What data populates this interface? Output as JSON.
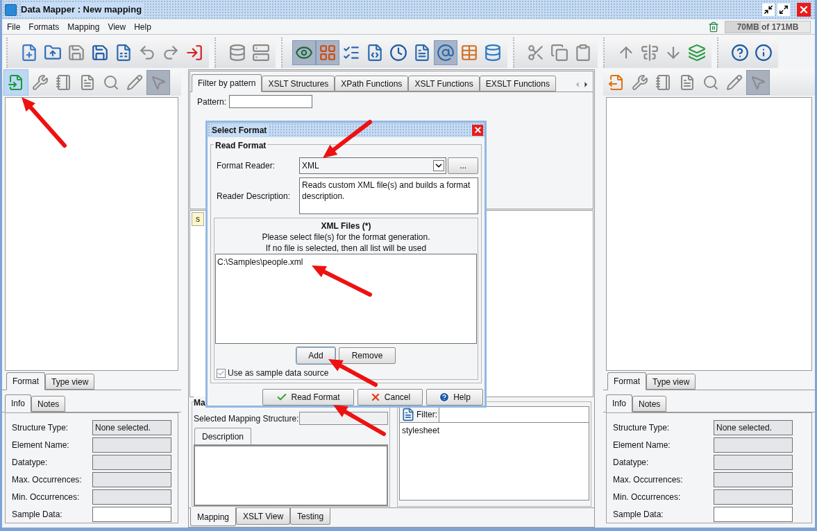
{
  "window": {
    "title": "Data Mapper : New mapping"
  },
  "menu": [
    {
      "label": "File"
    },
    {
      "label": "Formats"
    },
    {
      "label": "Mapping"
    },
    {
      "label": "View"
    },
    {
      "label": "Help"
    }
  ],
  "memory": {
    "label": "70MB of 171MB",
    "level": 0.42
  },
  "toolbar": {
    "groups": [
      [
        {
          "pressed": false,
          "disabled": false
        },
        {
          "pressed": false,
          "disabled": false
        },
        {
          "pressed": false,
          "disabled": true
        },
        {
          "pressed": false,
          "disabled": false
        },
        {
          "pressed": false,
          "disabled": false
        },
        {
          "pressed": false,
          "disabled": true
        },
        {
          "pressed": false,
          "disabled": true
        },
        {
          "pressed": false,
          "disabled": false
        }
      ],
      [
        {
          "pressed": false,
          "disabled": true
        },
        {
          "pressed": false,
          "disabled": true
        }
      ],
      [
        {
          "pressed": true,
          "disabled": false
        },
        {
          "pressed": true,
          "disabled": false
        },
        {
          "pressed": false,
          "disabled": false
        },
        {
          "pressed": false,
          "disabled": false
        },
        {
          "pressed": false,
          "disabled": false
        },
        {
          "pressed": false,
          "disabled": false
        },
        {
          "pressed": true,
          "disabled": false
        },
        {
          "pressed": false,
          "disabled": false
        },
        {
          "pressed": false,
          "disabled": false
        }
      ],
      [
        {
          "pressed": false,
          "disabled": true
        },
        {
          "pressed": false,
          "disabled": true
        },
        {
          "pressed": false,
          "disabled": true
        }
      ],
      [
        {
          "pressed": false,
          "disabled": true
        },
        {
          "pressed": false,
          "disabled": true
        },
        {
          "pressed": false,
          "disabled": true
        },
        {
          "pressed": false,
          "disabled": false
        }
      ],
      [
        {
          "pressed": false,
          "disabled": false
        },
        {
          "pressed": false,
          "disabled": false
        }
      ]
    ]
  },
  "left_panel": {
    "toolbar": [
      {
        "pressed": true,
        "disabled": false
      },
      {
        "pressed": false,
        "disabled": true
      },
      {
        "pressed": false,
        "disabled": true
      },
      {
        "pressed": false,
        "disabled": true
      },
      {
        "pressed": false,
        "disabled": true
      },
      {
        "pressed": false,
        "disabled": true
      },
      {
        "pressed": true,
        "disabled": true
      }
    ],
    "view_tabs": [
      {
        "label": "Format",
        "selected": true
      },
      {
        "label": "Type view",
        "selected": false
      }
    ],
    "info_tabs": [
      {
        "label": "Info",
        "selected": true
      },
      {
        "label": "Notes",
        "selected": false
      }
    ],
    "fields": [
      {
        "label": "Structure Type:",
        "value": "None selected.",
        "editable": false
      },
      {
        "label": "Element Name:",
        "editable": false
      },
      {
        "label": "Datatype:",
        "editable": false
      },
      {
        "label": "Max. Occurrences:",
        "editable": false
      },
      {
        "label": "Min. Occurrences:",
        "editable": false
      },
      {
        "label": "Sample Data:",
        "editable": true
      }
    ]
  },
  "center": {
    "function_tabs": [
      {
        "label": "Filter by pattern",
        "selected": true
      },
      {
        "label": "XSLT Structures",
        "selected": false
      },
      {
        "label": "XPath Functions",
        "selected": false
      },
      {
        "label": "XSLT Functions",
        "selected": false
      },
      {
        "label": "EXSLT Functions",
        "selected": false
      }
    ],
    "pattern_label": "Pattern:",
    "editor_tab": "s",
    "mapping_group": {
      "title": "Ma",
      "structure_label": "Selected Mapping Structure:",
      "description_tab": "Description",
      "filter_label": "Filter:",
      "items": [
        "stylesheet"
      ]
    },
    "bottom_tabs": [
      {
        "label": "Mapping",
        "selected": true
      },
      {
        "label": "XSLT View",
        "selected": false
      },
      {
        "label": "Testing",
        "selected": false
      }
    ]
  },
  "right_panel": {
    "toolbar": [
      {
        "pressed": false,
        "disabled": false
      },
      {
        "pressed": false,
        "disabled": true
      },
      {
        "pressed": false,
        "disabled": true
      },
      {
        "pressed": false,
        "disabled": true
      },
      {
        "pressed": false,
        "disabled": true
      },
      {
        "pressed": false,
        "disabled": true
      },
      {
        "pressed": true,
        "disabled": true
      }
    ],
    "view_tabs": [
      {
        "label": "Format",
        "selected": true
      },
      {
        "label": "Type view",
        "selected": false
      }
    ],
    "info_tabs": [
      {
        "label": "Info",
        "selected": true
      },
      {
        "label": "Notes",
        "selected": false
      }
    ],
    "fields": [
      {
        "label": "Structure Type:",
        "value": "None selected.",
        "editable": false
      },
      {
        "label": "Element Name:",
        "editable": false
      },
      {
        "label": "Datatype:",
        "editable": false
      },
      {
        "label": "Max. Occurrences:",
        "editable": false
      },
      {
        "label": "Min. Occurrences:",
        "editable": false
      },
      {
        "label": "Sample Data:",
        "editable": true
      }
    ]
  },
  "dialog": {
    "title": "Select Format",
    "section": "Read Format",
    "reader_label": "Format Reader:",
    "reader_value": "XML",
    "browse_button": "...",
    "description_label": "Reader Description:",
    "description": "Reads custom XML file(s) and builds a format description.",
    "files_title": "XML Files (*)",
    "files_hint": [
      "Please select file(s) for the format generation.",
      "If no file is selected, then all list will be used"
    ],
    "files": [
      {
        "path": "C:\\Samples\\people.xml"
      }
    ],
    "add_button": {
      "label": "Add",
      "focused": true
    },
    "remove_button": {
      "label": "Remove",
      "focused": false
    },
    "sample_checkbox": {
      "label": "Use as sample data source",
      "checked": true
    },
    "buttons": [
      {
        "label": "Read Format",
        "kind": "ok"
      },
      {
        "label": "Cancel",
        "kind": "cancel"
      },
      {
        "label": "Help",
        "kind": "help"
      }
    ]
  }
}
